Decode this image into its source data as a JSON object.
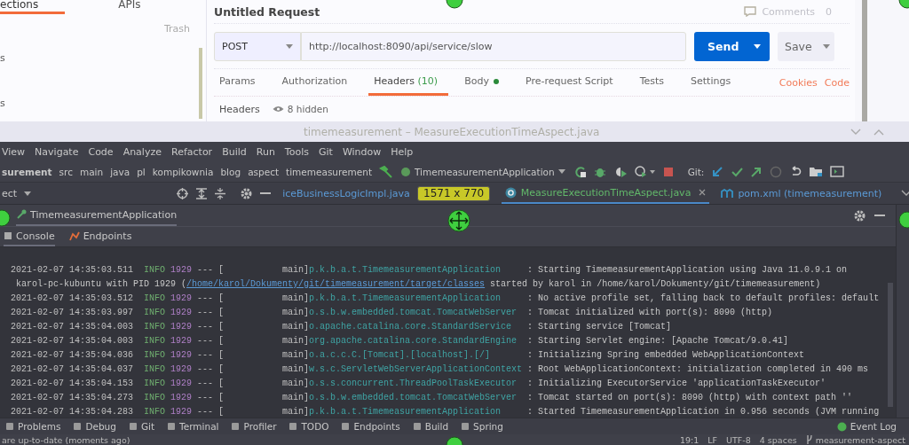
{
  "postman": {
    "sidebar": {
      "tabs": [
        {
          "label": "ections",
          "selected": true
        },
        {
          "label": "APIs",
          "selected": false
        }
      ],
      "trash": "Trash",
      "items": [
        "s",
        "s"
      ]
    },
    "request": {
      "title": "Untitled Request",
      "comments": {
        "label": "Comments",
        "count": "0"
      },
      "method": "POST",
      "url": "http://localhost:8090/api/service/slow",
      "send": "Send",
      "save": "Save",
      "tabs": [
        {
          "label": "Params",
          "selected": false,
          "dot": false
        },
        {
          "label": "Authorization",
          "selected": false,
          "dot": false
        },
        {
          "label": "Headers",
          "count": "(10)",
          "selected": true,
          "dot": false
        },
        {
          "label": "Body",
          "selected": false,
          "dot": true
        },
        {
          "label": "Pre-request Script",
          "selected": false,
          "dot": false
        },
        {
          "label": "Tests",
          "selected": false,
          "dot": false
        },
        {
          "label": "Settings",
          "selected": false,
          "dot": false
        }
      ],
      "links": [
        "Cookies",
        "Code"
      ],
      "headers_label": "Headers",
      "hidden": "8 hidden"
    }
  },
  "ide": {
    "title": "timemeasurement – MeasureExecutionTimeAspect.java",
    "menu": [
      "View",
      "Navigate",
      "Code",
      "Analyze",
      "Refactor",
      "Build",
      "Run",
      "Tools",
      "Git",
      "Window",
      "Help"
    ],
    "breadcrumb": [
      "surement",
      "src",
      "main",
      "java",
      "pl",
      "kompikownia",
      "blog",
      "aspect",
      "timemeasurement"
    ],
    "run_config": "TimemeasurementApplication",
    "git_label": "Git:",
    "project_label": "ect",
    "editor_tabs": [
      {
        "label": "iceBusinessLogicImpl.java",
        "selected": false,
        "kind": "plain"
      },
      {
        "label": "MeasureExecutionTimeAspect.java",
        "selected": true,
        "kind": "class"
      },
      {
        "label": "pom.xml (timemeasurement)",
        "selected": false,
        "kind": "maven"
      }
    ],
    "run_title": "TimemeasurementApplication",
    "console_tabs": [
      {
        "label": "Console",
        "selected": true
      },
      {
        "label": "Endpoints",
        "selected": false
      }
    ],
    "log": [
      {
        "kind": "entry",
        "date": "2021-02-07 14:35:03.511",
        "level": "INFO",
        "pid": "1929",
        "thread": "--- [           main]",
        "logger": "p.k.b.a.t.TimemeasurementApplication",
        "message": ": Starting TimemeasurementApplication using Java 11.0.9.1 on"
      },
      {
        "kind": "wrap",
        "before": " karol-pc-kubuntu with PID 1929 (",
        "link": "/home/karol/Dokumenty/git/timemeasurement/target/classes",
        "after": " started by karol in /home/karol/Dokumenty/git/timemeasurement)"
      },
      {
        "kind": "entry",
        "date": "2021-02-07 14:35:03.512",
        "level": "INFO",
        "pid": "1929",
        "thread": "--- [           main]",
        "logger": "p.k.b.a.t.TimemeasurementApplication",
        "message": ": No active profile set, falling back to default profiles: default"
      },
      {
        "kind": "entry",
        "date": "2021-02-07 14:35:03.997",
        "level": "INFO",
        "pid": "1929",
        "thread": "--- [           main]",
        "logger": "o.s.b.w.embedded.tomcat.TomcatWebServer",
        "message": ": Tomcat initialized with port(s): 8090 (http)"
      },
      {
        "kind": "entry",
        "date": "2021-02-07 14:35:04.003",
        "level": "INFO",
        "pid": "1929",
        "thread": "--- [           main]",
        "logger": "o.apache.catalina.core.StandardService",
        "message": ": Starting service [Tomcat]"
      },
      {
        "kind": "entry",
        "date": "2021-02-07 14:35:04.003",
        "level": "INFO",
        "pid": "1929",
        "thread": "--- [           main]",
        "logger": "org.apache.catalina.core.StandardEngine",
        "message": ": Starting Servlet engine: [Apache Tomcat/9.0.41]"
      },
      {
        "kind": "entry",
        "date": "2021-02-07 14:35:04.036",
        "level": "INFO",
        "pid": "1929",
        "thread": "--- [           main]",
        "logger": "o.a.c.c.C.[Tomcat].[localhost].[/]",
        "message": ": Initializing Spring embedded WebApplicationContext"
      },
      {
        "kind": "entry",
        "date": "2021-02-07 14:35:04.037",
        "level": "INFO",
        "pid": "1929",
        "thread": "--- [           main]",
        "logger": "w.s.c.ServletWebServerApplicationContext",
        "message": ": Root WebApplicationContext: initialization completed in 490 ms"
      },
      {
        "kind": "entry",
        "date": "2021-02-07 14:35:04.153",
        "level": "INFO",
        "pid": "1929",
        "thread": "--- [           main]",
        "logger": "o.s.s.concurrent.ThreadPoolTaskExecutor",
        "message": ": Initializing ExecutorService 'applicationTaskExecutor'"
      },
      {
        "kind": "entry",
        "date": "2021-02-07 14:35:04.273",
        "level": "INFO",
        "pid": "1929",
        "thread": "--- [           main]",
        "logger": "o.s.b.w.embedded.tomcat.TomcatWebServer",
        "message": ": Tomcat started on port(s): 8090 (http) with context path ''"
      },
      {
        "kind": "entry",
        "date": "2021-02-07 14:35:04.283",
        "level": "INFO",
        "pid": "1929",
        "thread": "--- [           main]",
        "logger": "p.k.b.a.t.TimemeasurementApplication",
        "message": ": Started TimemeasurementApplication in 0.956 seconds (JVM running"
      }
    ],
    "tool_windows": [
      "Problems",
      "Debug",
      "Git",
      "Terminal",
      "Profiler",
      "TODO",
      "Endpoints",
      "Build",
      "Spring"
    ],
    "event_log": "Event Log",
    "status": {
      "left": "are up-to-date (moments ago)",
      "right": [
        "19:1",
        "LF",
        "UTF-8",
        "4 spaces"
      ],
      "branch": "measurement-aspect"
    }
  },
  "capture": {
    "size": "1571 x 770"
  }
}
